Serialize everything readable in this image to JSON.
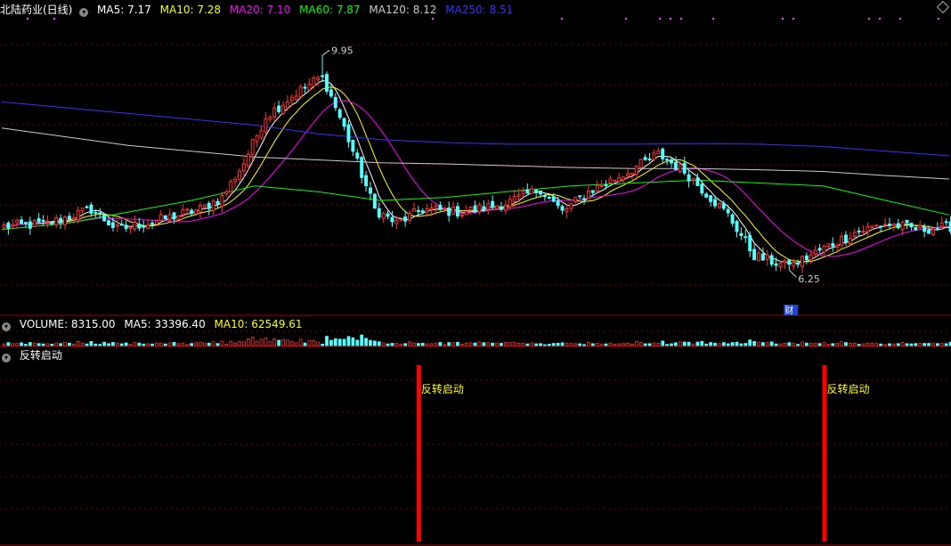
{
  "header": {
    "stock_name": "北陆药业(日线)",
    "ma": [
      {
        "label": "MA5: 7.17",
        "color": "#ffffff"
      },
      {
        "label": "MA10: 7.28",
        "color": "#ffff00"
      },
      {
        "label": "MA20: 7.10",
        "color": "#ff00ff"
      },
      {
        "label": "MA60: 7.87",
        "color": "#00ff00"
      },
      {
        "label": "MA120: 8.12",
        "color": "#cccccc"
      },
      {
        "label": "MA250: 8.51",
        "color": "#3333ff"
      }
    ]
  },
  "volume_header": {
    "volume": "VOLUME: 8315.00",
    "ma5": "MA5: 33396.40",
    "ma10": "MA10: 62549.61"
  },
  "indicator_header": {
    "name": "反转启动"
  },
  "chart_data": {
    "type": "candlestick",
    "price_range": [
      5.5,
      10.6
    ],
    "annotations": {
      "high_label": "9.95",
      "low_label": "6.25",
      "event_marker": "财",
      "signal_label": "反转启动"
    },
    "signals_at_index": [
      95,
      188
    ],
    "colors": {
      "up": "#ff3232",
      "down": "#54ffff",
      "ma5": "#ffffff",
      "ma10": "#ffff00",
      "ma20": "#ff00ff",
      "ma60": "#00ff00",
      "ma120": "#cccccc",
      "ma250": "#3333ff",
      "grid": "#7a0000",
      "signal": "#ff0000",
      "dot": "#ff44ff"
    },
    "keypoints": [
      [
        0,
        7.0
      ],
      [
        10,
        7.05
      ],
      [
        20,
        7.3
      ],
      [
        26,
        6.95
      ],
      [
        35,
        7.1
      ],
      [
        45,
        7.3
      ],
      [
        50,
        7.5
      ],
      [
        55,
        8.1
      ],
      [
        60,
        8.9
      ],
      [
        67,
        9.3
      ],
      [
        73,
        9.6
      ],
      [
        78,
        8.7
      ],
      [
        85,
        7.3
      ],
      [
        90,
        7.05
      ],
      [
        96,
        7.3
      ],
      [
        105,
        7.25
      ],
      [
        115,
        7.4
      ],
      [
        123,
        7.65
      ],
      [
        128,
        7.25
      ],
      [
        134,
        7.6
      ],
      [
        142,
        7.9
      ],
      [
        150,
        8.25
      ],
      [
        156,
        7.95
      ],
      [
        160,
        7.65
      ],
      [
        166,
        7.2
      ],
      [
        172,
        6.5
      ],
      [
        180,
        6.3
      ],
      [
        186,
        6.55
      ],
      [
        195,
        6.9
      ],
      [
        202,
        7.05
      ],
      [
        210,
        6.95
      ],
      [
        217,
        7.0
      ]
    ],
    "volume_scale_max": 100000
  }
}
